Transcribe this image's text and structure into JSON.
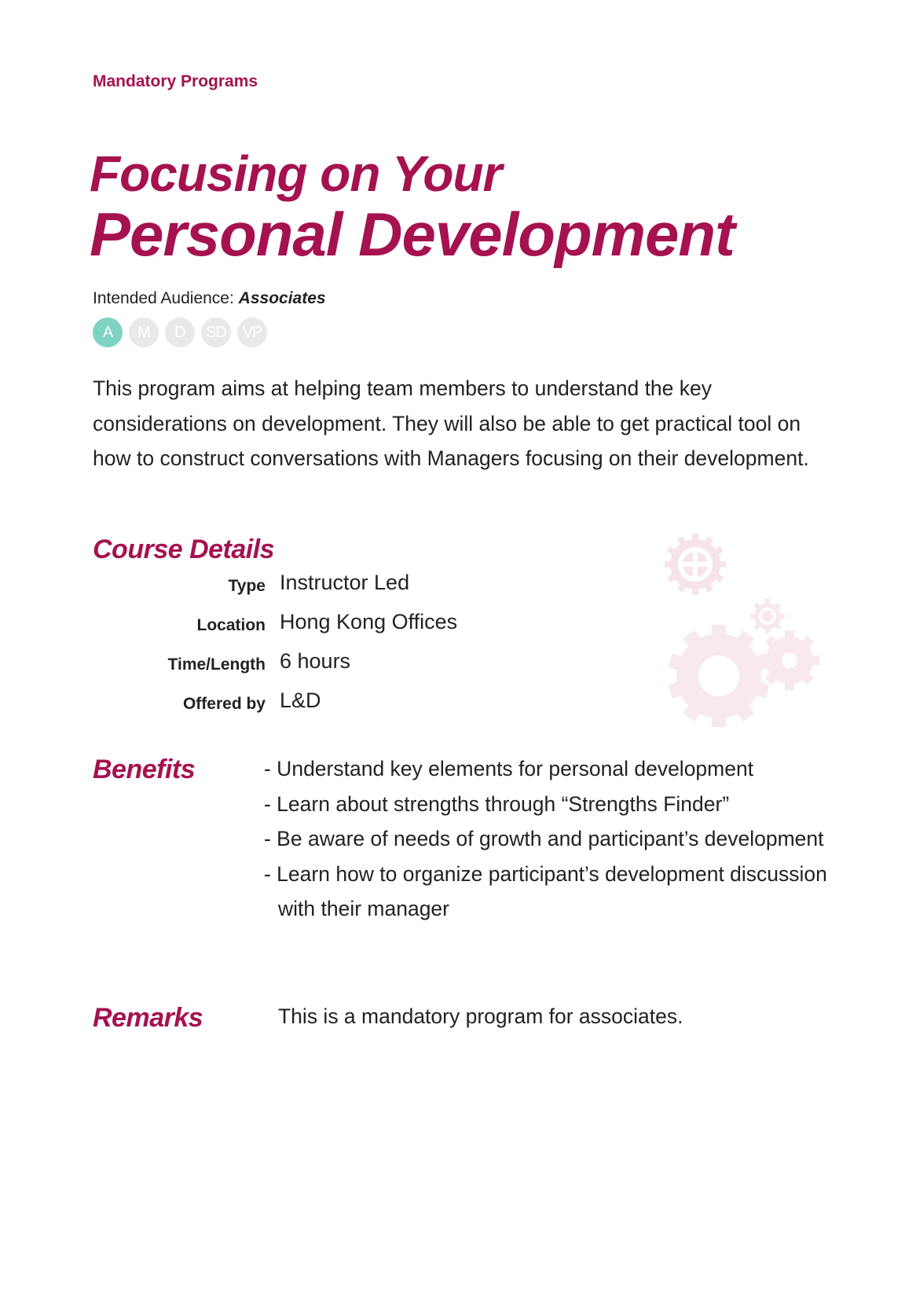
{
  "header": {
    "section": "Mandatory Programs",
    "title_line1": "Focusing on Your",
    "title_line2": "Personal Development"
  },
  "audience": {
    "label": "Intended Audience: ",
    "value": "Associates",
    "levels": [
      {
        "code": "A",
        "active": true
      },
      {
        "code": "M",
        "active": false
      },
      {
        "code": "D",
        "active": false
      },
      {
        "code": "SD",
        "active": false
      },
      {
        "code": "VP",
        "active": false
      }
    ]
  },
  "description": "This program aims at helping team members to understand the key considerations on development. They will also be able to get practical tool on how to construct conversations with Managers focusing on their development.",
  "course_details": {
    "heading": "Course Details",
    "rows": [
      {
        "key": "Type",
        "value": "Instructor Led"
      },
      {
        "key": "Location",
        "value": "Hong Kong Offices"
      },
      {
        "key": "Time/Length",
        "value": "6 hours"
      },
      {
        "key": "Offered by",
        "value": "L&D"
      }
    ]
  },
  "benefits": {
    "heading": "Benefits",
    "items": [
      "- Understand key elements for personal development",
      "- Learn about strengths through “Strengths Finder”",
      "- Be aware of needs of growth and participant’s development",
      "- Learn how to organize participant’s development discussion with their manager"
    ]
  },
  "remarks": {
    "heading": "Remarks",
    "text": "This is a mandatory program for associates."
  },
  "colors": {
    "brand": "#a5124f",
    "active_badge": "#7fd3c3",
    "inactive_badge": "#e9e9e9",
    "gear": "#f6e3ec"
  },
  "decor": {
    "icon": "gears-icon"
  }
}
